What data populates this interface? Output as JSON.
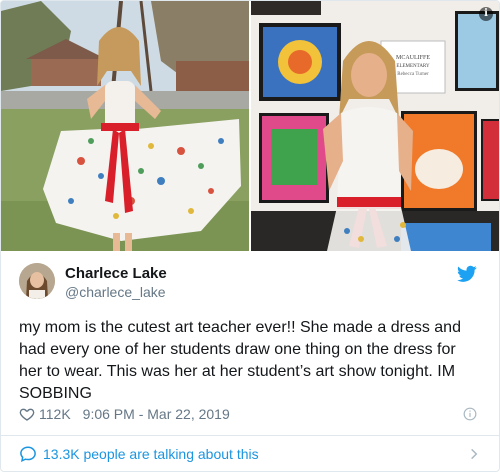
{
  "tweet": {
    "author_name": "Charlece Lake",
    "author_handle": "@charlece_lake",
    "text": "my mom is the cutest art teacher ever!! She made a dress and had every one of her students draw one thing on the dress for her to wear. This was her at her student’s art show tonight. IM SOBBING",
    "likes": "112K",
    "timestamp": "9:06 PM - Mar 22, 2019",
    "conversation": "13.3K people are talking about this"
  },
  "photos": {
    "sign_line1": "MCAULIFFE",
    "sign_line2": "ELEMENTARY",
    "sign_line3": "Rebecca Turner"
  },
  "icons": {
    "bird": "twitter-bird-icon",
    "heart": "heart-icon",
    "info": "info-icon",
    "conversation": "conversation-icon",
    "chevron": "chevron-right-icon"
  },
  "colors": {
    "accent": "#1da1f2",
    "link": "#1b95e0",
    "muted": "#657786",
    "text": "#14171a"
  }
}
